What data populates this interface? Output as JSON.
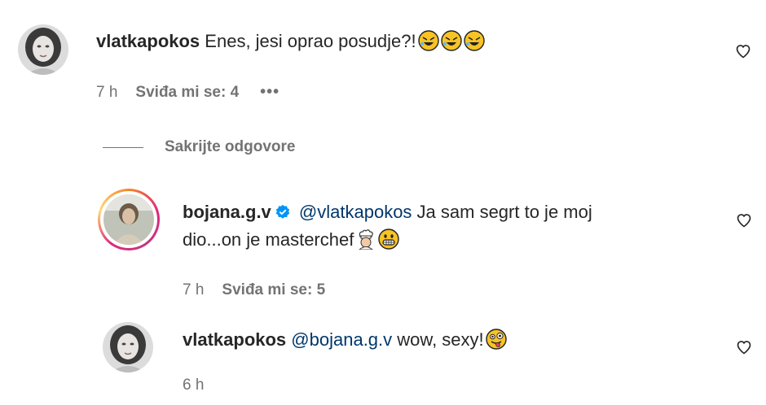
{
  "comments": [
    {
      "username": "vlatkapokos",
      "text": "Enes, jesi oprao posudje?!",
      "emojis": [
        "rofl-emoji",
        "rofl-emoji",
        "rofl-emoji"
      ],
      "time": "7 h",
      "likes": "Sviđa mi se: 4",
      "more": "•••"
    }
  ],
  "hide_replies_label": "Sakrijte odgovore",
  "replies": [
    {
      "username": "bojana.g.v",
      "verified": true,
      "mention": "@vlatkapokos",
      "text_line1": " Ja sam segrt to je moj",
      "text_line2": "dio...on je masterchef",
      "emojis": [
        "cook-emoji",
        "grin-emoji"
      ],
      "time": "7 h",
      "likes": "Sviđa mi se: 5"
    },
    {
      "username": "vlatkapokos",
      "mention": "@bojana.g.v",
      "text": " wow, sexy!",
      "emojis": [
        "tongue-wink-emoji"
      ],
      "time": "6 h"
    }
  ]
}
